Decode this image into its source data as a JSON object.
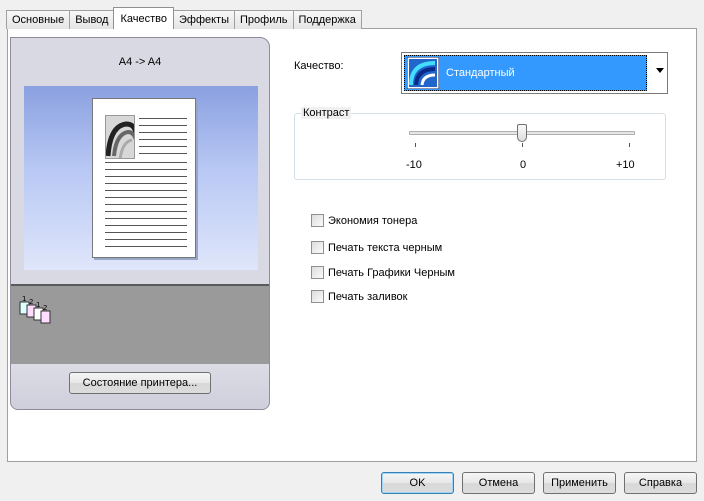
{
  "tabs": [
    {
      "label": "Основные"
    },
    {
      "label": "Вывод"
    },
    {
      "label": "Качество"
    },
    {
      "label": "Эффекты"
    },
    {
      "label": "Профиль"
    },
    {
      "label": "Поддержка"
    }
  ],
  "active_tab": "Качество",
  "preview": {
    "paper_size": "A4 -> A4",
    "printer_status_button": "Состояние принтера..."
  },
  "quality": {
    "label": "Качество:",
    "selected": "Стандартный",
    "icon": "quality-standard-icon"
  },
  "contrast": {
    "title": "Контраст",
    "min_label": "-10",
    "mid_label": "0",
    "max_label": "+10",
    "value": 0
  },
  "options": [
    {
      "label": "Экономия тонера",
      "checked": false
    },
    {
      "label": "Печать текста черным",
      "checked": false
    },
    {
      "label": "Печать Графики Черным",
      "checked": false
    },
    {
      "label": "Печать заливок",
      "checked": false
    }
  ],
  "buttons": {
    "ok": "OK",
    "cancel": "Отмена",
    "apply": "Применить",
    "help": "Справка"
  },
  "colors": {
    "selection": "#3399ff",
    "preview_blue": "#8aa0e0"
  }
}
